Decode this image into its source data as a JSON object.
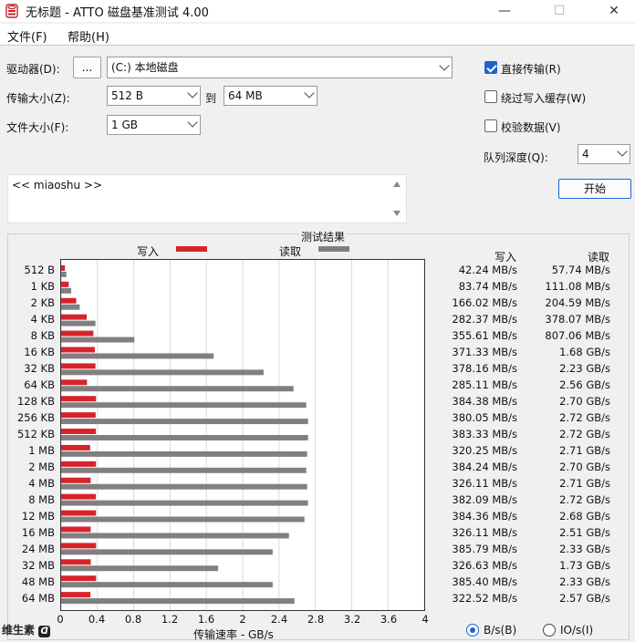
{
  "window": {
    "title": "无标题 - ATTO 磁盘基准测试 4.00",
    "minimize": "—",
    "maximize": "☐",
    "close": "✕"
  },
  "menu": [
    "文件(F)",
    "帮助(H)"
  ],
  "settings": {
    "drive_label": "驱动器(D):",
    "browse_label": "...",
    "drive_value": "(C:) 本地磁盘",
    "transfer_label": "传输大小(Z):",
    "transfer_from": "512 B",
    "to_label": "到",
    "transfer_to": "64 MB",
    "file_size_label": "文件大小(F):",
    "file_size_value": "1 GB",
    "direct_io": {
      "label": "直接传输(R)",
      "checked": true
    },
    "bypass_cache": {
      "label": "绕过写入缓存(W)",
      "checked": false
    },
    "verify": {
      "label": "校验数据(V)",
      "checked": false
    },
    "queue_label": "队列深度(Q):",
    "queue_value": "4",
    "start_label": "开始"
  },
  "description": "<< miaoshu >>",
  "results": {
    "title": "测试结果",
    "legend_write": "写入",
    "legend_read": "读取",
    "col_write": "写入",
    "col_read": "读取",
    "xlabel": "传输速率 - GB/s",
    "unit_bs": "B/s(B)",
    "unit_ios": "IO/s(I)",
    "unit_selected": "B/s"
  },
  "colors": {
    "write": "#d8232a",
    "read": "#808080",
    "accent": "#1d63d4"
  },
  "watermark": "维生素",
  "chart_data": {
    "type": "bar",
    "orientation": "horizontal",
    "xlim": [
      0,
      4
    ],
    "xticks": [
      "0",
      "0.4",
      "0.8",
      "1.2",
      "1.6",
      "2",
      "2.4",
      "2.8",
      "3.2",
      "3.6",
      "4"
    ],
    "categories": [
      "512 B",
      "1 KB",
      "2 KB",
      "4 KB",
      "8 KB",
      "16 KB",
      "32 KB",
      "64 KB",
      "128 KB",
      "256 KB",
      "512 KB",
      "1 MB",
      "2 MB",
      "4 MB",
      "8 MB",
      "12 MB",
      "16 MB",
      "24 MB",
      "32 MB",
      "48 MB",
      "64 MB"
    ],
    "series": [
      {
        "name": "写入",
        "values": [
          0.04224,
          0.08374,
          0.16602,
          0.28237,
          0.35561,
          0.37133,
          0.37816,
          0.28511,
          0.38438,
          0.38005,
          0.38333,
          0.32025,
          0.38424,
          0.32611,
          0.38209,
          0.38436,
          0.32611,
          0.38579,
          0.32663,
          0.3854,
          0.32252
        ],
        "labels": [
          "42.24 MB/s",
          "83.74 MB/s",
          "166.02 MB/s",
          "282.37 MB/s",
          "355.61 MB/s",
          "371.33 MB/s",
          "378.16 MB/s",
          "285.11 MB/s",
          "384.38 MB/s",
          "380.05 MB/s",
          "383.33 MB/s",
          "320.25 MB/s",
          "384.24 MB/s",
          "326.11 MB/s",
          "382.09 MB/s",
          "384.36 MB/s",
          "326.11 MB/s",
          "385.79 MB/s",
          "326.63 MB/s",
          "385.40 MB/s",
          "322.52 MB/s"
        ]
      },
      {
        "name": "读取",
        "values": [
          0.05774,
          0.11108,
          0.20459,
          0.37807,
          0.80706,
          1.68,
          2.23,
          2.56,
          2.7,
          2.72,
          2.72,
          2.71,
          2.7,
          2.71,
          2.72,
          2.68,
          2.51,
          2.33,
          1.73,
          2.33,
          2.57
        ],
        "labels": [
          "57.74 MB/s",
          "111.08 MB/s",
          "204.59 MB/s",
          "378.07 MB/s",
          "807.06 MB/s",
          "1.68 GB/s",
          "2.23 GB/s",
          "2.56 GB/s",
          "2.70 GB/s",
          "2.72 GB/s",
          "2.72 GB/s",
          "2.71 GB/s",
          "2.70 GB/s",
          "2.71 GB/s",
          "2.72 GB/s",
          "2.68 GB/s",
          "2.51 GB/s",
          "2.33 GB/s",
          "1.73 GB/s",
          "2.33 GB/s",
          "2.57 GB/s"
        ]
      }
    ]
  }
}
